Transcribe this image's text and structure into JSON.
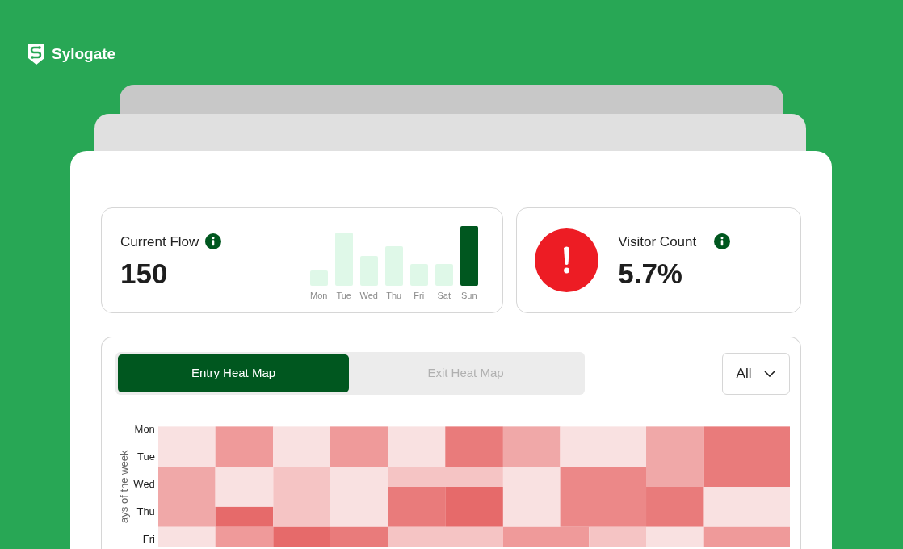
{
  "brand": {
    "name": "Sylogate"
  },
  "current_flow": {
    "title": "Current Flow",
    "value": "150",
    "bars": [
      {
        "label": "Mon",
        "highlighted": false
      },
      {
        "label": "Tue",
        "highlighted": false
      },
      {
        "label": "Wed",
        "highlighted": false
      },
      {
        "label": "Thu",
        "highlighted": false
      },
      {
        "label": "Fri",
        "highlighted": false
      },
      {
        "label": "Sat",
        "highlighted": false
      },
      {
        "label": "Sun",
        "highlighted": true
      }
    ]
  },
  "visitor_count": {
    "title": "Visitor Count",
    "value": "5.7%",
    "alert": true
  },
  "heatmap": {
    "tabs": [
      {
        "label": "Entry Heat Map",
        "selected": true
      },
      {
        "label": "Exit Heat Map",
        "selected": false
      }
    ],
    "filter": {
      "value": "All"
    },
    "y_axis_title": "ays of the week",
    "row_labels": [
      "Mon",
      "Tue",
      "Wed",
      "Thu",
      "Fri"
    ]
  }
}
